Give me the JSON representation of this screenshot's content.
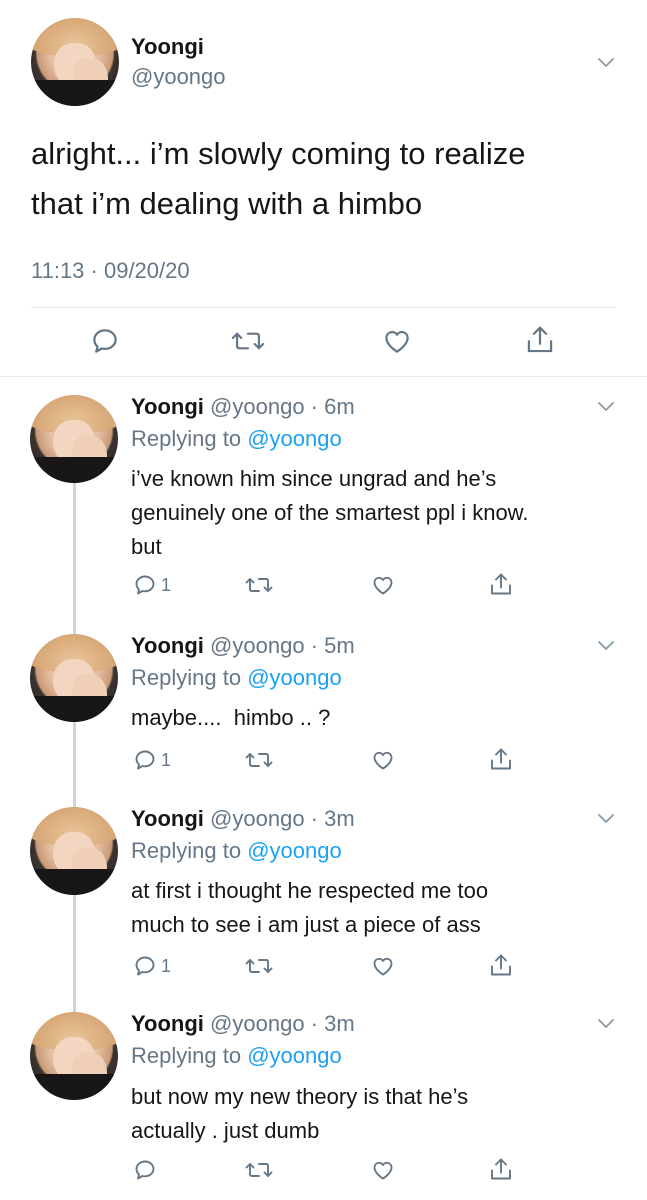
{
  "main_tweet": {
    "name": "Yoongi",
    "handle": "@yoongo",
    "text_line1": "alright... i’m slowly coming to realize",
    "text_line2": "that i’m dealing with a himbo",
    "timestamp": "11:13 · 09/20/20"
  },
  "replies": [
    {
      "name": "Yoongi",
      "meta": "@yoongo · 6m",
      "replying_prefix": "Replying to",
      "replying_to": "@yoongo",
      "lines": [
        "i’ve known him since ungrad and he’s",
        "genuinely one of the smartest ppl i know.",
        "but"
      ],
      "reply_count": "1"
    },
    {
      "name": "Yoongi",
      "meta": "@yoongo · 5m",
      "replying_prefix": "Replying to",
      "replying_to": "@yoongo",
      "lines": [
        "maybe....  himbo .. ?"
      ],
      "reply_count": "1"
    },
    {
      "name": "Yoongi",
      "meta": "@yoongo · 3m",
      "replying_prefix": "Replying to",
      "replying_to": "@yoongo",
      "lines": [
        "at first i thought he respected me too",
        "much to see i am just a piece of ass"
      ],
      "reply_count": "1"
    },
    {
      "name": "Yoongi",
      "meta": "@yoongo · 3m",
      "replying_prefix": "Replying to",
      "replying_to": "@yoongo",
      "lines": [
        "but now my new theory is that he’s",
        "actually . just dumb"
      ],
      "reply_count": ""
    }
  ],
  "icons": {
    "reply": "reply-icon",
    "retweet": "retweet-icon",
    "like": "heart-icon",
    "share": "share-icon",
    "more": "chevron-down-icon"
  },
  "colors": {
    "accent": "#1da1f2",
    "secondary_text": "#657786",
    "icon": "#657786",
    "thread_line": "#ccd6dd"
  }
}
